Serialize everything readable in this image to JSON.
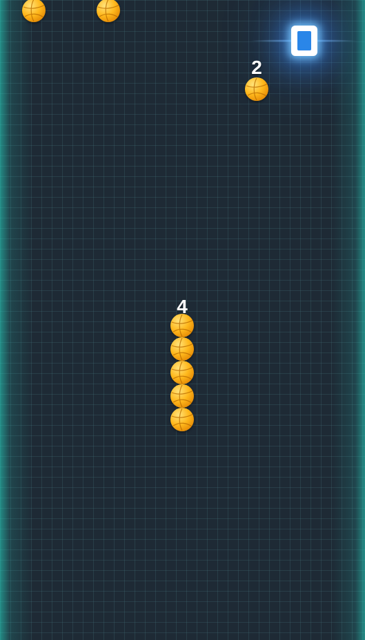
{
  "hud": {
    "pause_icon": "pause-icon",
    "accent_color": "#2a86e8"
  },
  "pickups": [
    {
      "count": "",
      "icon": "ball-icon"
    },
    {
      "count": "",
      "icon": "ball-icon"
    },
    {
      "count": "2",
      "icon": "ball-icon"
    }
  ],
  "snake": {
    "length_label": "4",
    "segment_icon": "ball-icon",
    "segments_visible": 5
  }
}
